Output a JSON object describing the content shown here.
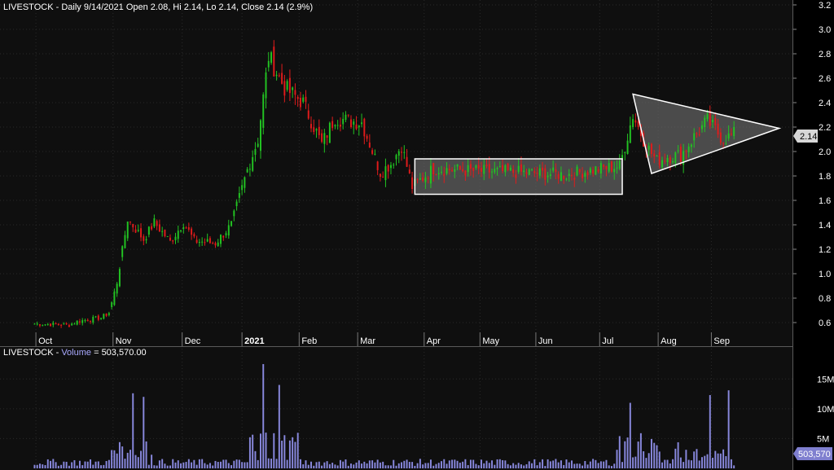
{
  "header": {
    "price_title": "LIVESTOCK - Daily 9/14/2021 Open 2.08, Hi 2.14, Lo 2.14, Close 2.14 (2.9%)",
    "volume_prefix": "LIVESTOCK - ",
    "volume_label": "Volume",
    "volume_value": " = 503,570.00"
  },
  "last_price_badge": "2.14",
  "last_volume_badge": "503,570",
  "colors": {
    "background": "#000000",
    "panel": "#0f0f0f",
    "grid": "#2a2a2a",
    "up": "#22c322",
    "down": "#e01b1b",
    "volume": "#8888dd",
    "volume_label": "#a9a9ff",
    "pattern_fill": "#6b6b6b",
    "pattern_stroke": "#ffffff",
    "badge_price": "#d7d7d7",
    "badge_volume": "#7f7fcf"
  },
  "chart_data": [
    {
      "type": "candlestick",
      "y_ticks": [
        "0.6",
        "0.8",
        "1.0",
        "1.2",
        "1.4",
        "1.6",
        "1.8",
        "2.0",
        "2.2",
        "2.4",
        "2.6",
        "2.8",
        "3.0",
        "3.2"
      ],
      "ylim": [
        0.5,
        3.25
      ],
      "months": [
        "Oct",
        "Nov",
        "Dec",
        "2021",
        "Feb",
        "Mar",
        "Apr",
        "May",
        "Jun",
        "Jul",
        "Aug",
        "Sep"
      ],
      "month_positions": [
        0.5,
        29.5,
        55.5,
        78,
        99.5,
        121.5,
        146.5,
        167.5,
        188.5,
        212.5,
        234.5,
        254.5
      ],
      "x_range": [
        -13,
        285
      ],
      "anchors": [
        [
          0,
          0.59
        ],
        [
          13,
          0.58
        ],
        [
          16,
          0.61
        ],
        [
          25,
          0.64
        ],
        [
          28,
          0.68
        ],
        [
          31,
          0.93
        ],
        [
          35,
          1.45
        ],
        [
          41,
          1.28
        ],
        [
          45,
          1.42
        ],
        [
          51,
          1.26
        ],
        [
          56,
          1.42
        ],
        [
          60,
          1.27
        ],
        [
          68,
          1.25
        ],
        [
          74,
          1.4
        ],
        [
          80,
          1.85
        ],
        [
          84,
          2.1
        ],
        [
          88,
          2.78
        ],
        [
          94,
          2.52
        ],
        [
          101,
          2.4
        ],
        [
          108,
          2.06
        ],
        [
          113,
          2.28
        ],
        [
          118,
          2.25
        ],
        [
          123,
          2.24
        ],
        [
          130,
          1.83
        ],
        [
          134,
          1.9
        ],
        [
          138,
          2.05
        ],
        [
          142,
          1.71
        ],
        [
          150,
          1.86
        ],
        [
          166,
          1.84
        ],
        [
          182,
          1.83
        ],
        [
          200,
          1.81
        ],
        [
          213,
          1.86
        ],
        [
          220,
          1.88
        ],
        [
          225,
          2.3
        ],
        [
          230,
          2.05
        ],
        [
          234,
          1.92
        ],
        [
          238,
          1.96
        ],
        [
          243,
          1.97
        ],
        [
          248,
          2.12
        ],
        [
          253,
          2.25
        ],
        [
          259,
          2.1
        ],
        [
          263,
          2.14
        ]
      ],
      "series": [
        {
          "values": [
            []
          ]
        }
      ],
      "last_close": 2.14
    },
    {
      "type": "bar",
      "y_ticks": [
        "5M",
        "10M",
        "15M"
      ],
      "ylim": [
        0,
        19
      ],
      "series": [
        {
          "name": "Volume",
          "values": []
        }
      ],
      "last_volume": 503570
    }
  ],
  "patterns": [
    {
      "type": "rectangle",
      "x": [
        143,
        221
      ],
      "y": [
        1.65,
        1.94
      ]
    },
    {
      "type": "triangle",
      "points": [
        [
          225,
          2.47
        ],
        [
          232,
          1.82
        ],
        [
          280,
          2.19
        ]
      ]
    }
  ]
}
